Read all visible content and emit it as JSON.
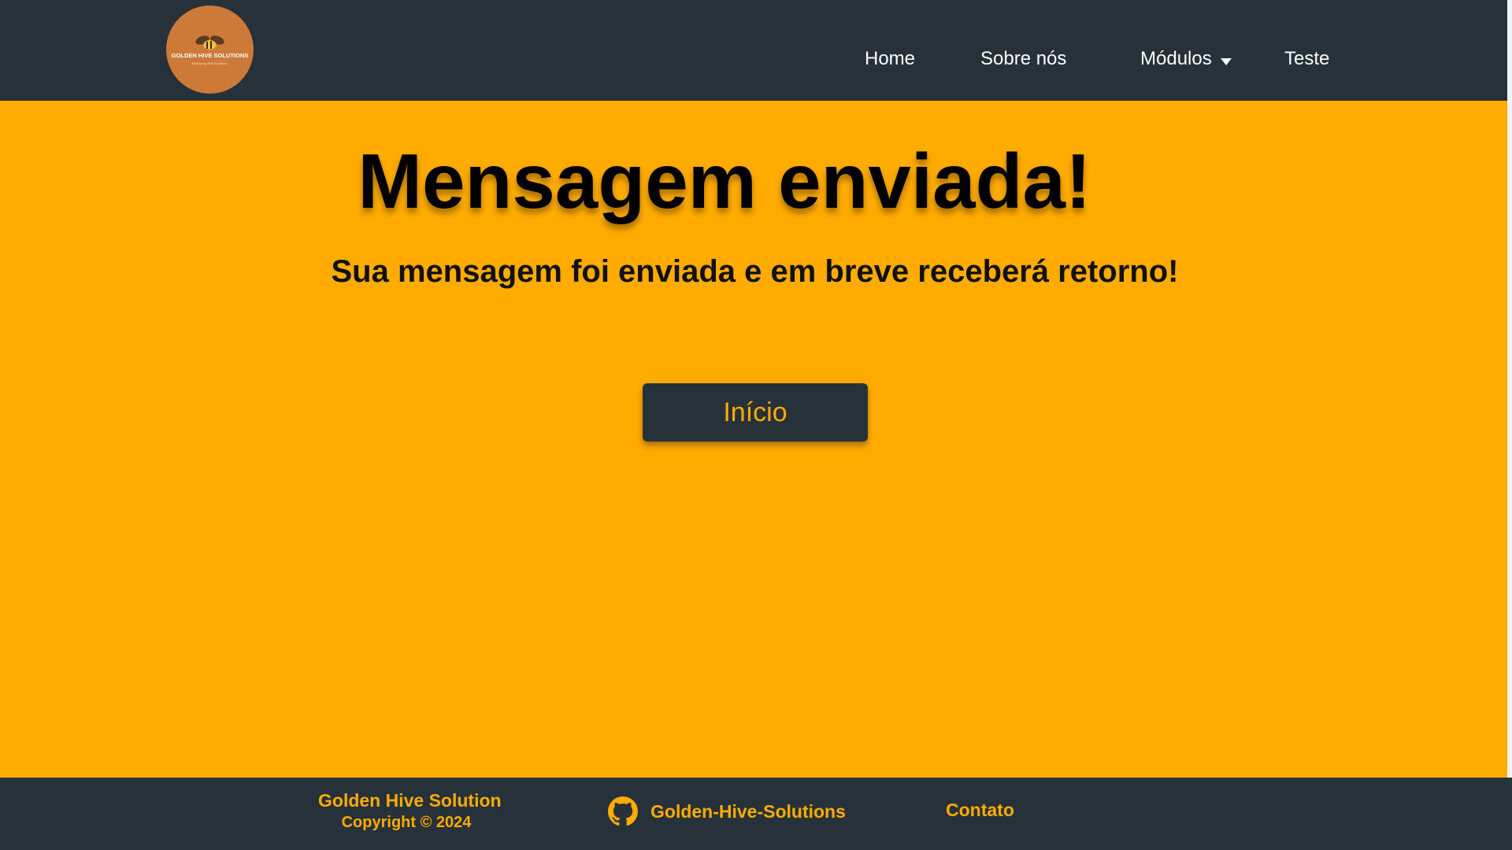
{
  "header": {
    "logo": {
      "text": "GOLDEN HIVE SOLUTIONS",
      "tagline": "Beekeeping With Excellence",
      "icon": "bee-icon"
    },
    "nav": [
      {
        "label": "Home"
      },
      {
        "label": "Sobre nós"
      },
      {
        "label": "Módulos",
        "icon": "caret-down-icon"
      },
      {
        "label": "Teste"
      }
    ]
  },
  "main": {
    "title": "Mensagem enviada!",
    "subtitle": "Sua mensagem foi enviada e em breve receberá retorno!",
    "button_label": "Início"
  },
  "footer": {
    "brand": "Golden Hive Solution",
    "copyright": "Copyright © 2024",
    "github": {
      "label": "Golden-Hive-Solutions",
      "icon": "github-icon"
    },
    "contact_label": "Contato"
  },
  "colors": {
    "background": "#ffab00",
    "dark": "#263139",
    "accent": "#ffab00",
    "logo_bg": "#cd7a39"
  }
}
